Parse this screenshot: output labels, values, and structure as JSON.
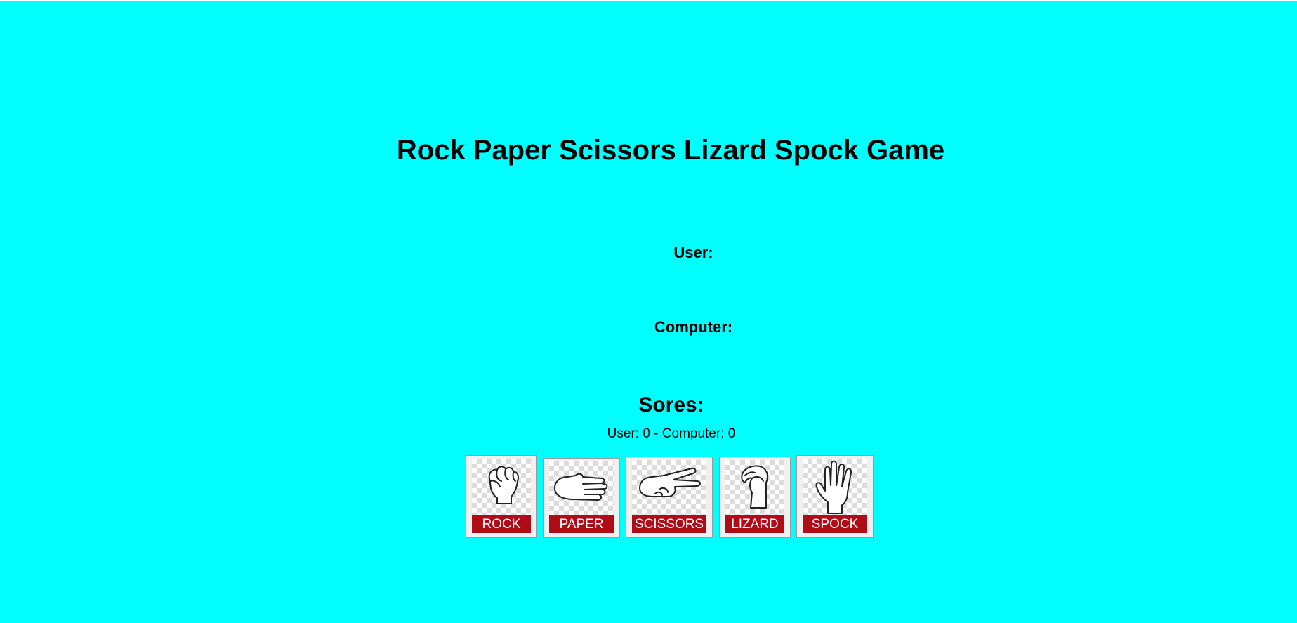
{
  "game": {
    "title": "Rock Paper Scissors Lizard Spock Game",
    "user_label": "User:",
    "computer_label": "Computer:",
    "scores_heading": "Sores:",
    "scores_text": "User: 0 - Computer: 0"
  },
  "choices": [
    {
      "label": "ROCK",
      "icon": "rock-hand-icon"
    },
    {
      "label": "PAPER",
      "icon": "paper-hand-icon"
    },
    {
      "label": "SCISSORS",
      "icon": "scissors-hand-icon"
    },
    {
      "label": "LIZARD",
      "icon": "lizard-hand-icon"
    },
    {
      "label": "SPOCK",
      "icon": "spock-hand-icon"
    }
  ],
  "colors": {
    "background": "#00ffff",
    "banner": "#b00c18"
  }
}
